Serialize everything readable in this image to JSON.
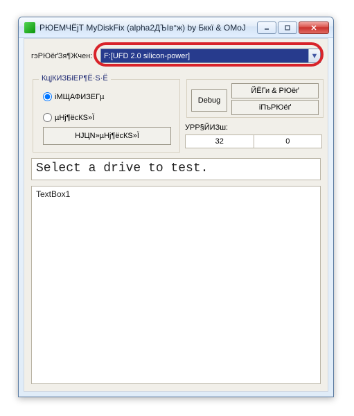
{
  "window": {
    "title": "РЮЕМЧЁјТ MyDiskFix (alpha2ДЪІв°ж) by Бккї & OMoJ"
  },
  "drive": {
    "label": "гэРЮёґЗя¶Жчен:",
    "selected": "F:[UFD 2.0 silicon-power]"
  },
  "modeGroup": {
    "title": "КцјКИЗБіЕР¶Ё·Ѕ·Ё",
    "option1": "іМЩАФИЗЕГµ",
    "option2": "µНј¶ёсКЅ»Ї",
    "startButton": "НЈЦN»µНј¶ёсКЅ»Ї"
  },
  "rightPanel": {
    "debug": "Debug",
    "button1": "ЙЁГи & РЮёґ",
    "button2": "іПъРЮёґ"
  },
  "stats": {
    "label": "УРР§ЙИЗш:",
    "val1": "32",
    "val2": "0"
  },
  "message": "Select a drive to test.",
  "textbox": "TextBox1"
}
